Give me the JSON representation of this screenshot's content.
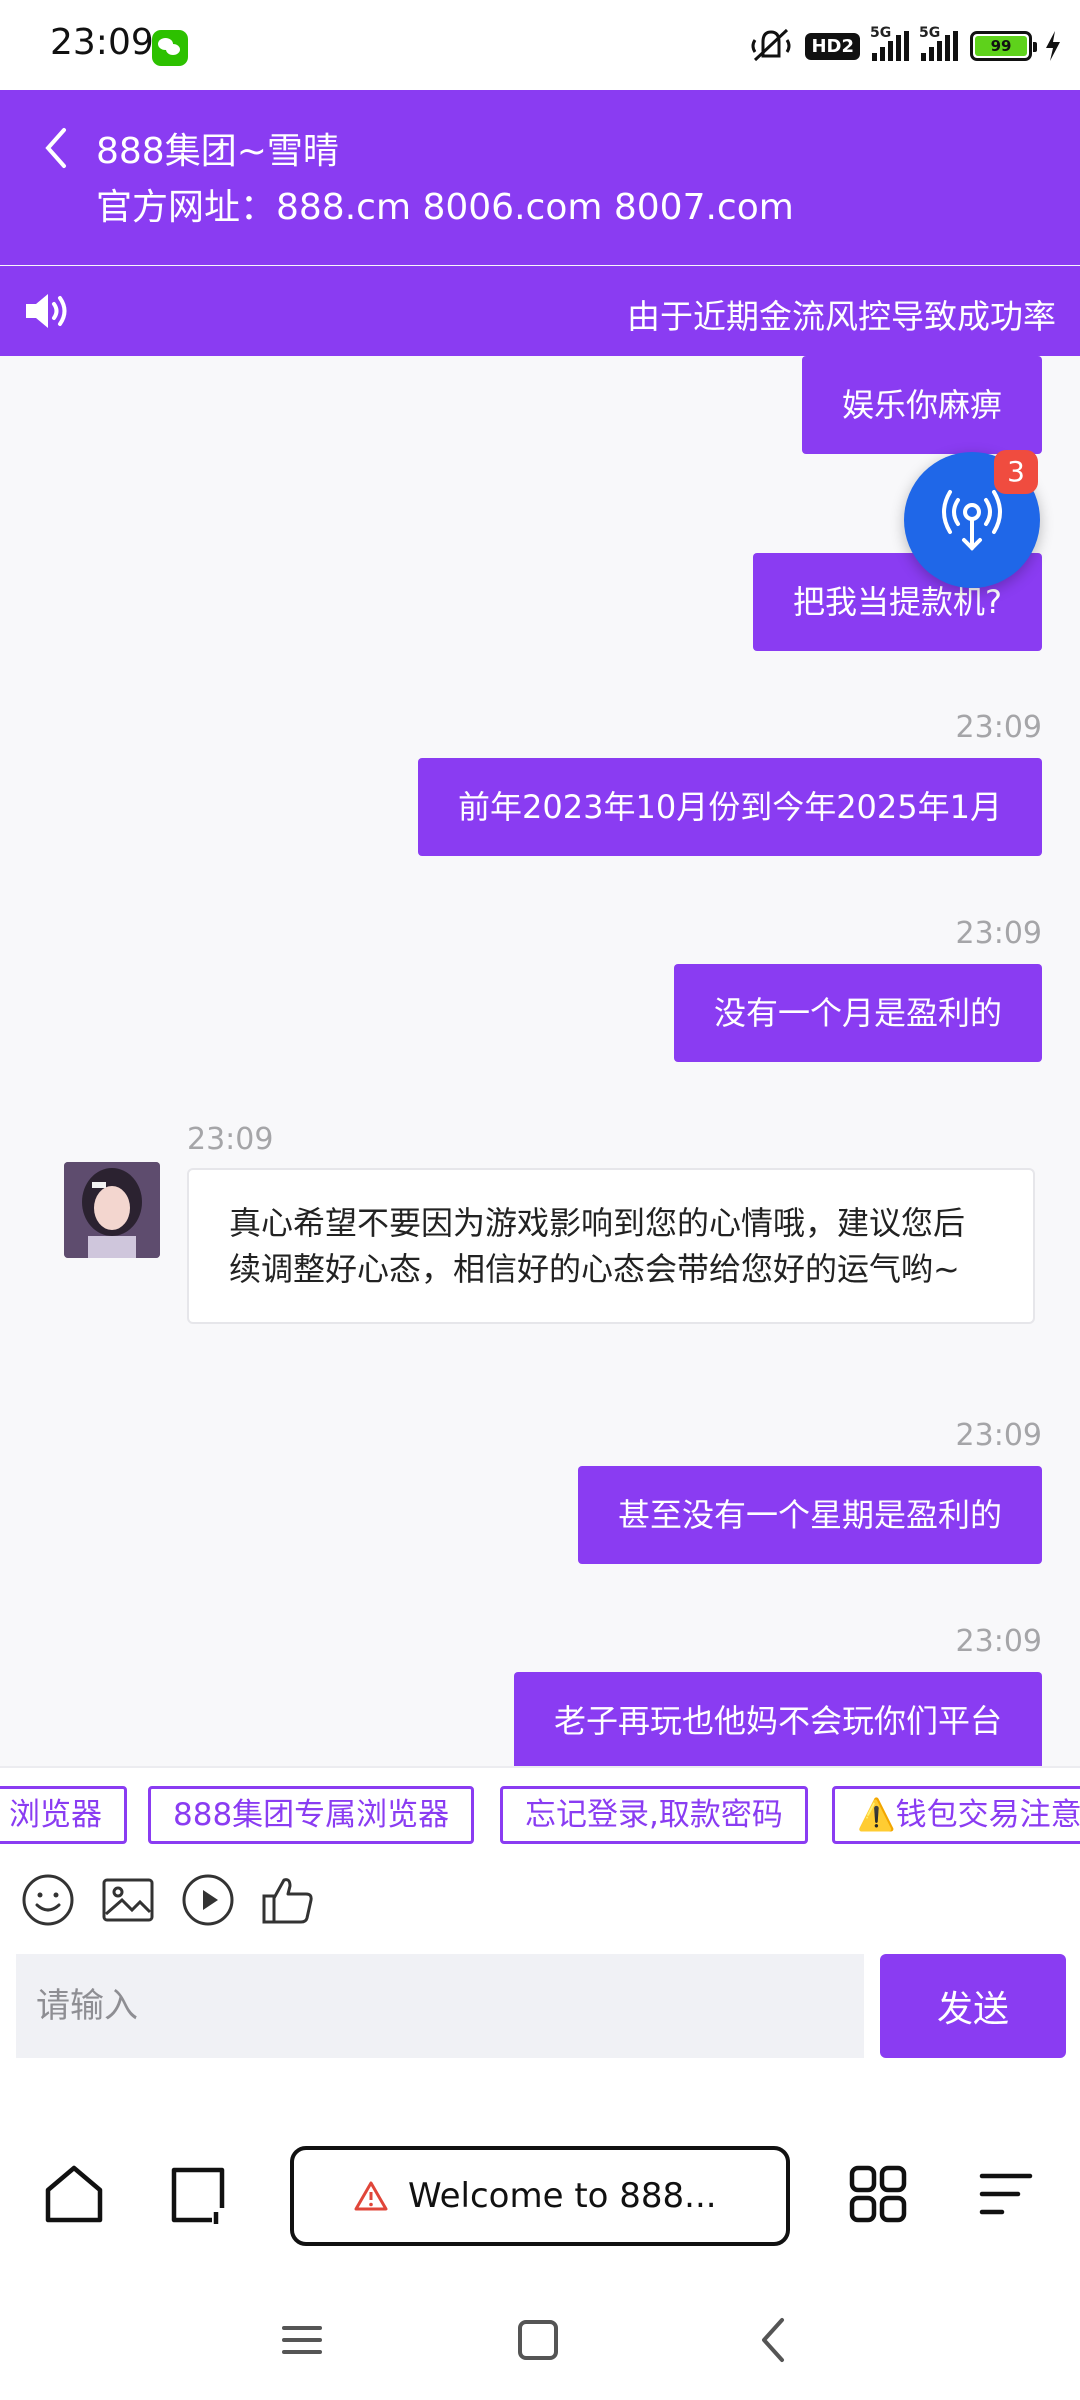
{
  "status": {
    "time": "23:09",
    "hd": "HD2",
    "net1": "5G",
    "net2": "5G",
    "battery": "99"
  },
  "header": {
    "title": "888集团~雪晴",
    "url": "官方网址：888.cm 8006.com 8007.com"
  },
  "notice": {
    "text": "由于近期金流风控导致成功率"
  },
  "fab": {
    "badge": "3"
  },
  "messages": {
    "m1": "娱乐你麻痹",
    "m2": "把我当提款机?",
    "m3_time": "23:09",
    "m3": "前年2023年10月份到今年2025年1月",
    "m4_time": "23:09",
    "m4": "没有一个月是盈利的",
    "m5_time": "23:09",
    "m5": "真心希望不要因为游戏影响到您的心情哦，建议您后续调整好心态，相信好的心态会带给您好的运气哟~",
    "m6_time": "23:09",
    "m6": "甚至没有一个星期是盈利的",
    "m7_time": "23:09",
    "m7": "老子再玩也他妈不会玩你们平台"
  },
  "quick_replies": [
    "浏览器",
    "888集团专属浏览器",
    "忘记登录,取款密码",
    "⚠️钱包交易注意"
  ],
  "input": {
    "placeholder": "请输入",
    "send_label": "发送"
  },
  "browser": {
    "tab_title": "Welcome to 888..."
  },
  "colors": {
    "brand": "#8a3cf2",
    "fab": "#1f67e8",
    "badge": "#f04c3f"
  }
}
